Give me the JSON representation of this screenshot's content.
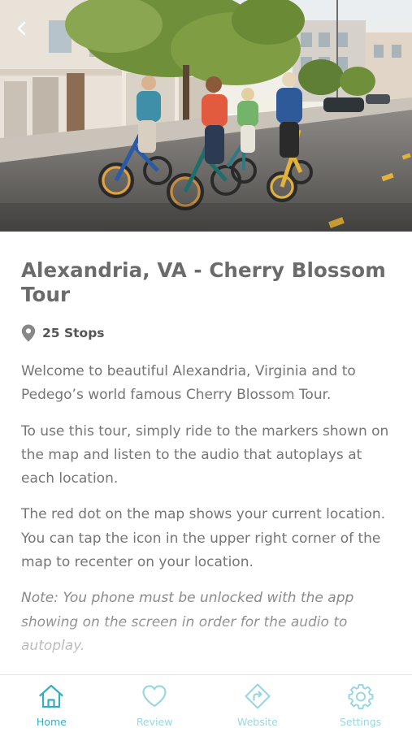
{
  "header": {
    "back_icon": "chevron-left-icon",
    "hero_image": "group-riding-electric-bikes-on-city-street"
  },
  "tour": {
    "title": "Alexandria, VA - Cherry Blossom Tour",
    "stops_icon": "map-pin-icon",
    "stops_label": "25 Stops",
    "paragraphs": [
      "Welcome to beautiful Alexandria, Virginia and to Pedego’s world famous Cherry Blossom Tour.",
      "To use this tour, simply ride to the markers shown on the map and listen to the audio that autoplays at each location.",
      "The red dot on the map shows your current location. You can tap the icon in the upper right corner of the map to recenter on your location."
    ],
    "note": "Note: You phone must be unlocked with the app showing on the screen in order for the audio to autoplay."
  },
  "tabbar": {
    "tabs": [
      {
        "label": "Home",
        "icon": "home-icon",
        "active": true
      },
      {
        "label": "Review",
        "icon": "heart-icon",
        "active": false
      },
      {
        "label": "Website",
        "icon": "directions-icon",
        "active": false
      },
      {
        "label": "Settings",
        "icon": "gear-icon",
        "active": false
      }
    ]
  },
  "colors": {
    "accent": "#37aebf",
    "accent_inactive": "#9ad7e0",
    "title_text": "#6b6b6b",
    "body_text": "#757575"
  }
}
